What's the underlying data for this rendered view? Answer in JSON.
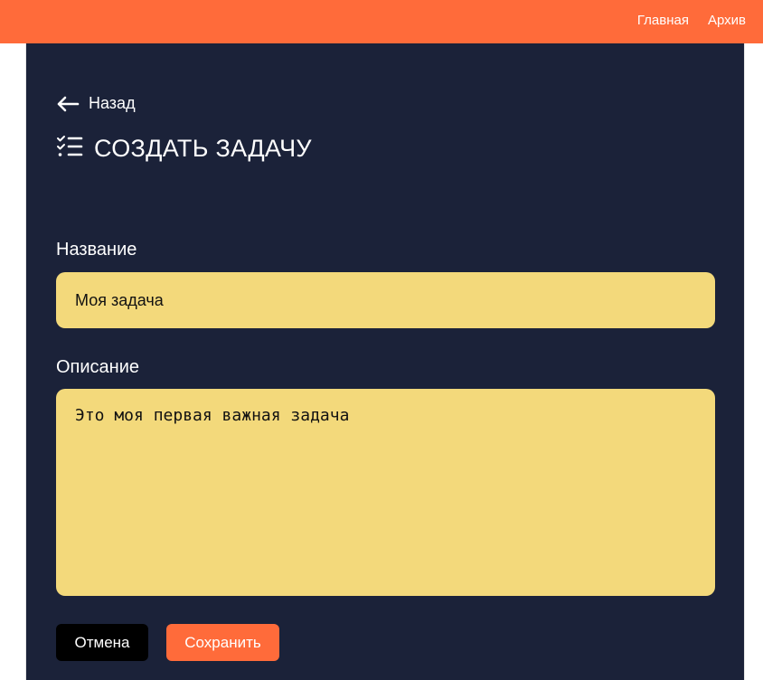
{
  "nav": {
    "home_label": "Главная",
    "archive_label": "Архив"
  },
  "page": {
    "back_label": "Назад",
    "title": "СОЗДАТЬ ЗАДАЧУ",
    "back_icon": "arrow-left-icon",
    "title_icon": "checklist-icon"
  },
  "form": {
    "name_label": "Название",
    "name_value": "Моя задача",
    "description_label": "Описание",
    "description_value": "Это моя первая важная задача",
    "cancel_label": "Отмена",
    "save_label": "Сохранить"
  },
  "colors": {
    "accent": "#ff6b3a",
    "background": "#1b2239",
    "field": "#f3d97b",
    "cancel_button": "#000000"
  }
}
